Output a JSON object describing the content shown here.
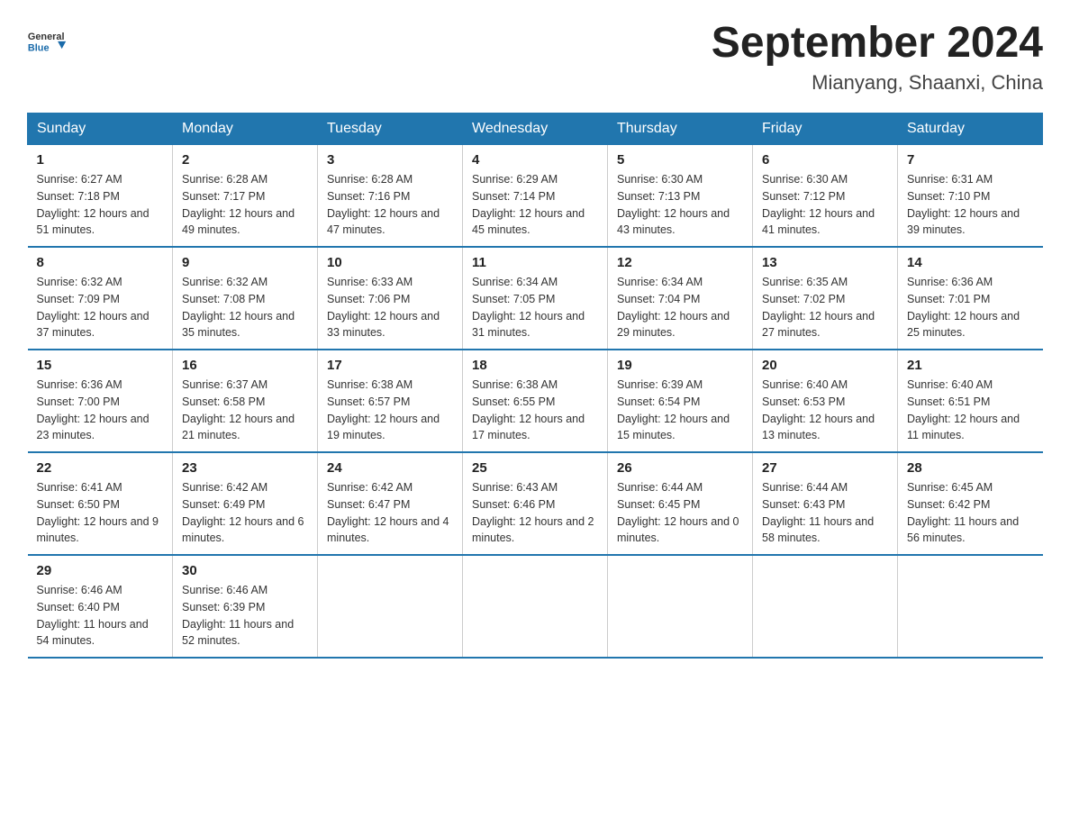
{
  "header": {
    "logo_general": "General",
    "logo_blue": "Blue",
    "title": "September 2024",
    "subtitle": "Mianyang, Shaanxi, China"
  },
  "days_of_week": [
    "Sunday",
    "Monday",
    "Tuesday",
    "Wednesday",
    "Thursday",
    "Friday",
    "Saturday"
  ],
  "weeks": [
    [
      {
        "day": "1",
        "sunrise": "6:27 AM",
        "sunset": "7:18 PM",
        "daylight": "12 hours and 51 minutes."
      },
      {
        "day": "2",
        "sunrise": "6:28 AM",
        "sunset": "7:17 PM",
        "daylight": "12 hours and 49 minutes."
      },
      {
        "day": "3",
        "sunrise": "6:28 AM",
        "sunset": "7:16 PM",
        "daylight": "12 hours and 47 minutes."
      },
      {
        "day": "4",
        "sunrise": "6:29 AM",
        "sunset": "7:14 PM",
        "daylight": "12 hours and 45 minutes."
      },
      {
        "day": "5",
        "sunrise": "6:30 AM",
        "sunset": "7:13 PM",
        "daylight": "12 hours and 43 minutes."
      },
      {
        "day": "6",
        "sunrise": "6:30 AM",
        "sunset": "7:12 PM",
        "daylight": "12 hours and 41 minutes."
      },
      {
        "day": "7",
        "sunrise": "6:31 AM",
        "sunset": "7:10 PM",
        "daylight": "12 hours and 39 minutes."
      }
    ],
    [
      {
        "day": "8",
        "sunrise": "6:32 AM",
        "sunset": "7:09 PM",
        "daylight": "12 hours and 37 minutes."
      },
      {
        "day": "9",
        "sunrise": "6:32 AM",
        "sunset": "7:08 PM",
        "daylight": "12 hours and 35 minutes."
      },
      {
        "day": "10",
        "sunrise": "6:33 AM",
        "sunset": "7:06 PM",
        "daylight": "12 hours and 33 minutes."
      },
      {
        "day": "11",
        "sunrise": "6:34 AM",
        "sunset": "7:05 PM",
        "daylight": "12 hours and 31 minutes."
      },
      {
        "day": "12",
        "sunrise": "6:34 AM",
        "sunset": "7:04 PM",
        "daylight": "12 hours and 29 minutes."
      },
      {
        "day": "13",
        "sunrise": "6:35 AM",
        "sunset": "7:02 PM",
        "daylight": "12 hours and 27 minutes."
      },
      {
        "day": "14",
        "sunrise": "6:36 AM",
        "sunset": "7:01 PM",
        "daylight": "12 hours and 25 minutes."
      }
    ],
    [
      {
        "day": "15",
        "sunrise": "6:36 AM",
        "sunset": "7:00 PM",
        "daylight": "12 hours and 23 minutes."
      },
      {
        "day": "16",
        "sunrise": "6:37 AM",
        "sunset": "6:58 PM",
        "daylight": "12 hours and 21 minutes."
      },
      {
        "day": "17",
        "sunrise": "6:38 AM",
        "sunset": "6:57 PM",
        "daylight": "12 hours and 19 minutes."
      },
      {
        "day": "18",
        "sunrise": "6:38 AM",
        "sunset": "6:55 PM",
        "daylight": "12 hours and 17 minutes."
      },
      {
        "day": "19",
        "sunrise": "6:39 AM",
        "sunset": "6:54 PM",
        "daylight": "12 hours and 15 minutes."
      },
      {
        "day": "20",
        "sunrise": "6:40 AM",
        "sunset": "6:53 PM",
        "daylight": "12 hours and 13 minutes."
      },
      {
        "day": "21",
        "sunrise": "6:40 AM",
        "sunset": "6:51 PM",
        "daylight": "12 hours and 11 minutes."
      }
    ],
    [
      {
        "day": "22",
        "sunrise": "6:41 AM",
        "sunset": "6:50 PM",
        "daylight": "12 hours and 9 minutes."
      },
      {
        "day": "23",
        "sunrise": "6:42 AM",
        "sunset": "6:49 PM",
        "daylight": "12 hours and 6 minutes."
      },
      {
        "day": "24",
        "sunrise": "6:42 AM",
        "sunset": "6:47 PM",
        "daylight": "12 hours and 4 minutes."
      },
      {
        "day": "25",
        "sunrise": "6:43 AM",
        "sunset": "6:46 PM",
        "daylight": "12 hours and 2 minutes."
      },
      {
        "day": "26",
        "sunrise": "6:44 AM",
        "sunset": "6:45 PM",
        "daylight": "12 hours and 0 minutes."
      },
      {
        "day": "27",
        "sunrise": "6:44 AM",
        "sunset": "6:43 PM",
        "daylight": "11 hours and 58 minutes."
      },
      {
        "day": "28",
        "sunrise": "6:45 AM",
        "sunset": "6:42 PM",
        "daylight": "11 hours and 56 minutes."
      }
    ],
    [
      {
        "day": "29",
        "sunrise": "6:46 AM",
        "sunset": "6:40 PM",
        "daylight": "11 hours and 54 minutes."
      },
      {
        "day": "30",
        "sunrise": "6:46 AM",
        "sunset": "6:39 PM",
        "daylight": "11 hours and 52 minutes."
      },
      null,
      null,
      null,
      null,
      null
    ]
  ],
  "labels": {
    "sunrise": "Sunrise:",
    "sunset": "Sunset:",
    "daylight": "Daylight:"
  }
}
